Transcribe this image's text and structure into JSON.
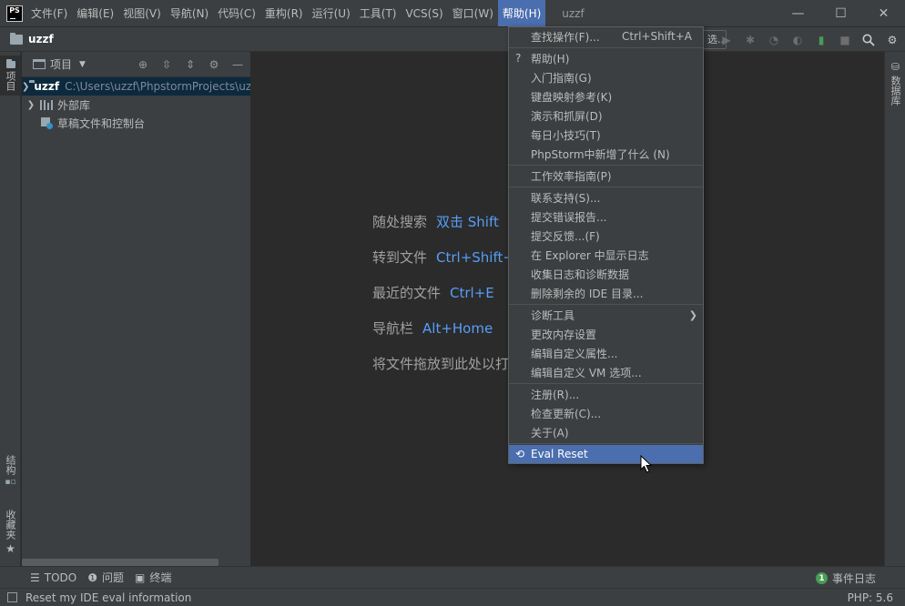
{
  "app": {
    "logo": "PS",
    "window_title": "uzzf"
  },
  "menubar": {
    "items": [
      {
        "id": "file",
        "label": "文件(F)"
      },
      {
        "id": "edit",
        "label": "编辑(E)"
      },
      {
        "id": "view",
        "label": "视图(V)"
      },
      {
        "id": "navigate",
        "label": "导航(N)"
      },
      {
        "id": "code",
        "label": "代码(C)"
      },
      {
        "id": "refactor",
        "label": "重构(R)"
      },
      {
        "id": "run",
        "label": "运行(U)"
      },
      {
        "id": "tools",
        "label": "工具(T)"
      },
      {
        "id": "vcs",
        "label": "VCS(S)"
      },
      {
        "id": "window",
        "label": "窗口(W)"
      },
      {
        "id": "help",
        "label": "帮助(H)"
      }
    ],
    "active": "help"
  },
  "window_controls": {
    "minimize": "—",
    "maximize": "☐",
    "close": "✕"
  },
  "navbar": {
    "project": "uzzf",
    "run_config": "选..."
  },
  "left_strip": {
    "project_tab": "项目",
    "structure_tab": "结构",
    "favorites_tab": "收藏夹"
  },
  "right_strip": {
    "database_tab": "数据库"
  },
  "project_panel": {
    "title": "项目",
    "tree": [
      {
        "name": "uzzf",
        "path": "C:\\Users\\uzzf\\PhpstormProjects\\uzzf"
      },
      {
        "name": "外部库"
      },
      {
        "name": "草稿文件和控制台"
      }
    ]
  },
  "editor_hints": [
    {
      "text": "随处搜索",
      "key": "双击 Shift"
    },
    {
      "text": "转到文件",
      "key": "Ctrl+Shift+N"
    },
    {
      "text": "最近的文件",
      "key": "Ctrl+E"
    },
    {
      "text": "导航栏",
      "key": "Alt+Home"
    },
    {
      "text": "将文件拖放到此处以打开",
      "key": ""
    }
  ],
  "help_menu": {
    "find_action": {
      "label": "查找操作(F)...",
      "shortcut": "Ctrl+Shift+A"
    },
    "help": {
      "label": "帮助(H)",
      "icon": "?"
    },
    "getting_started": "入门指南(G)",
    "keymap": "键盘映射参考(K)",
    "demos": "演示和抓屏(D)",
    "tip_of_day": "每日小技巧(T)",
    "whats_new": "PhpStorm中新增了什么 (N)",
    "productivity": "工作效率指南(P)",
    "contact_support": "联系支持(S)...",
    "submit_bug": "提交错误报告...",
    "submit_feedback": "提交反馈...(F)",
    "show_log": "在 Explorer 中显示日志",
    "collect_logs": "收集日志和诊断数据",
    "delete_leftover": "删除剩余的 IDE 目录...",
    "diagnostic_tools": "诊断工具",
    "change_memory": "更改内存设置",
    "edit_properties": "编辑自定义属性...",
    "edit_vm_options": "编辑自定义 VM 选项...",
    "register": "注册(R)...",
    "check_updates": "检查更新(C)...",
    "about": "关于(A)",
    "eval_reset": "Eval Reset"
  },
  "bottom_tools": {
    "todo": "TODO",
    "problems": "问题",
    "terminal": "终端",
    "event_log": "事件日志",
    "event_count": "1"
  },
  "statusbar": {
    "message": "Reset my IDE eval information",
    "php_version": "PHP: 5.6"
  },
  "colors": {
    "accent": "#4b6eaf",
    "link": "#589df6",
    "background": "#2b2b2b",
    "panel": "#3c3f41"
  }
}
